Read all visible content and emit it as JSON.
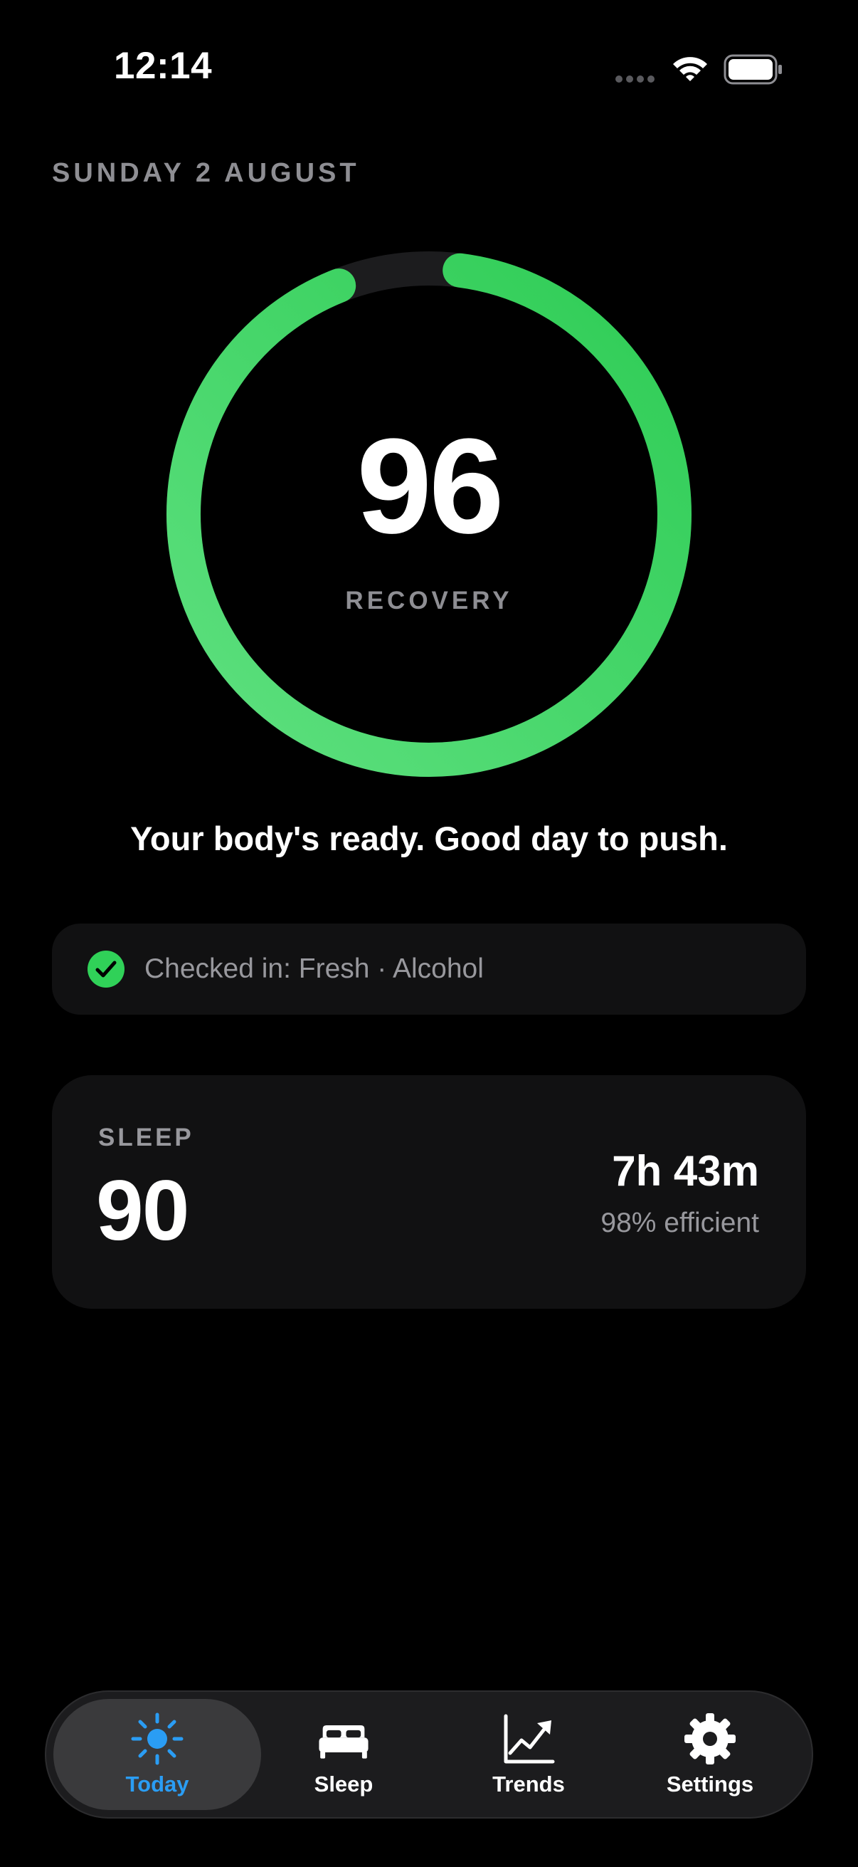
{
  "status_bar": {
    "time": "12:14"
  },
  "header": {
    "date": "SUNDAY 2 AUGUST"
  },
  "recovery": {
    "score": "96",
    "label": "RECOVERY",
    "progress": 0.96,
    "color_start": "#5ee07f",
    "color_end": "#30d158"
  },
  "message": "Your body's ready. Good day to push.",
  "checkin": {
    "text": "Checked in: Fresh · Alcohol",
    "icon": "checkmark-circle-icon",
    "color": "#30d158"
  },
  "sleep": {
    "label": "SLEEP",
    "score": "90",
    "duration": "7h 43m",
    "efficiency": "98% efficient"
  },
  "tabs": [
    {
      "label": "Today",
      "icon": "sun-icon",
      "active": true,
      "color": "#2a9df4"
    },
    {
      "label": "Sleep",
      "icon": "bed-icon"
    },
    {
      "label": "Trends",
      "icon": "chart-line-icon"
    },
    {
      "label": "Settings",
      "icon": "gear-icon"
    }
  ]
}
